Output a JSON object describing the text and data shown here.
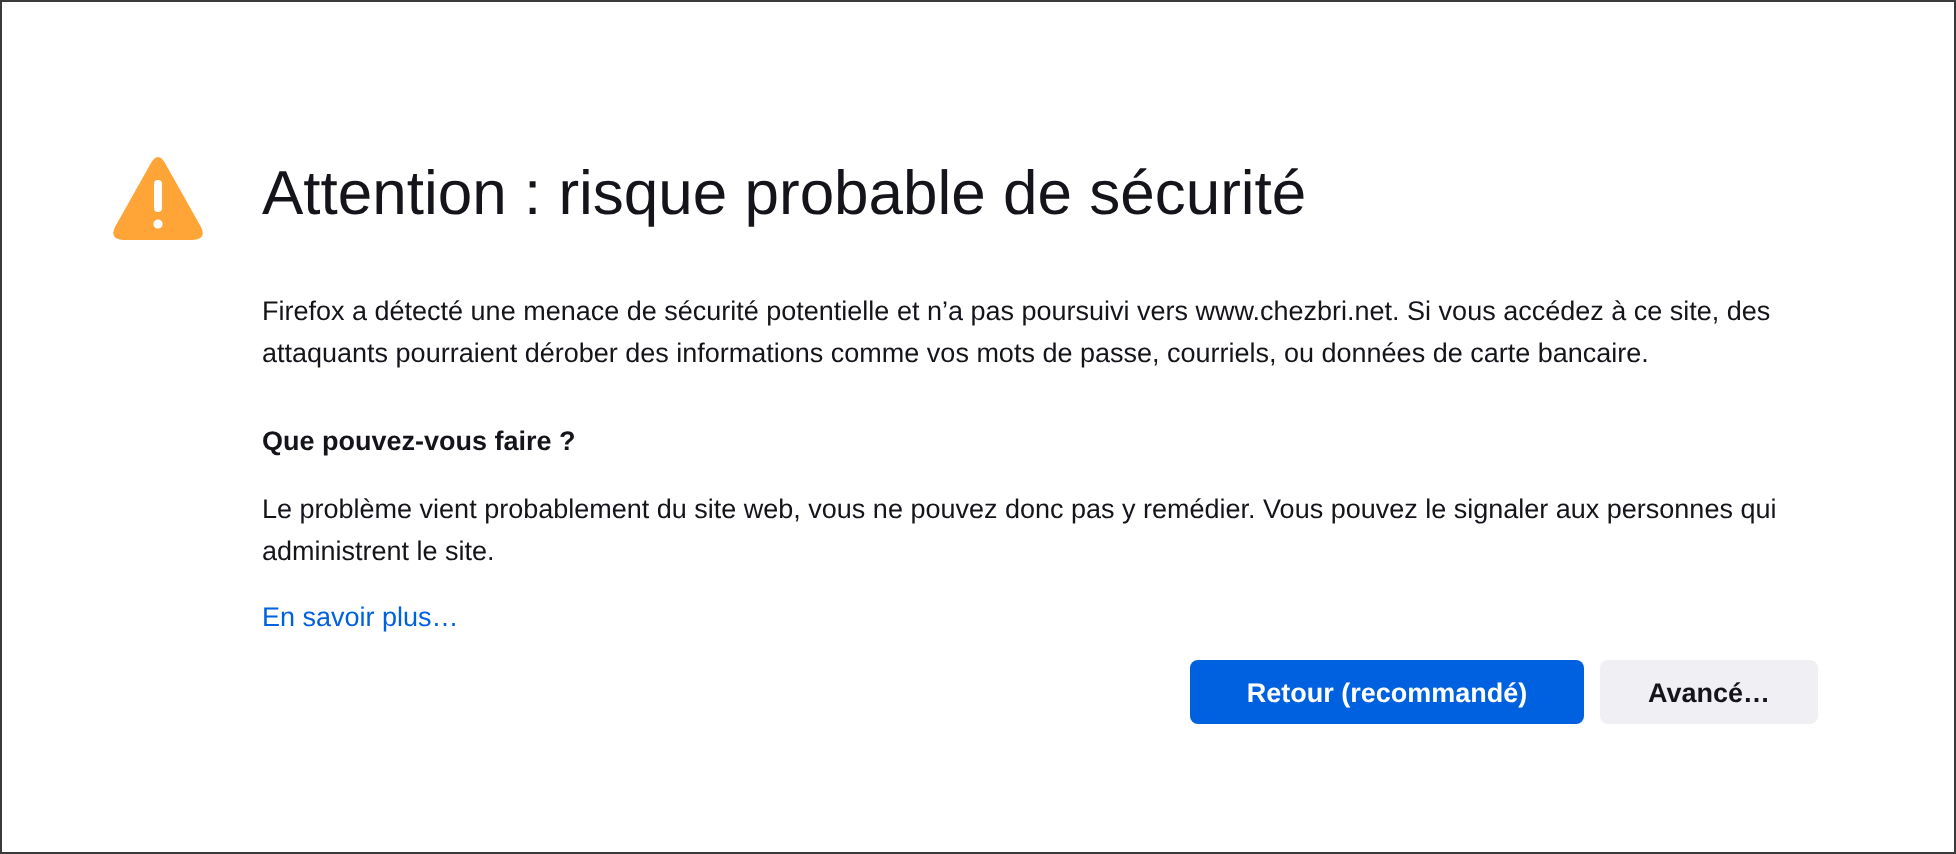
{
  "title": "Attention : risque probable de sécurité",
  "intro": "Firefox a détecté une menace de sécurité potentielle et n’a pas poursuivi vers www.chezbri.net. Si vous accédez à ce site, des attaquants pourraient dérober des informations comme vos mots de passe, courriels, ou données de carte bancaire.",
  "what_to_do": {
    "heading": "Que pouvez-vous faire ?",
    "text": "Le problème vient probablement du site web, vous ne pouvez donc pas y remédier. Vous pouvez le signaler aux personnes qui administrent le site."
  },
  "learn_more_link": "En savoir plus…",
  "buttons": [
    {
      "label": "Retour (recommandé)",
      "kind": "primary"
    },
    {
      "label": "Avancé…",
      "kind": "secondary"
    }
  ]
}
